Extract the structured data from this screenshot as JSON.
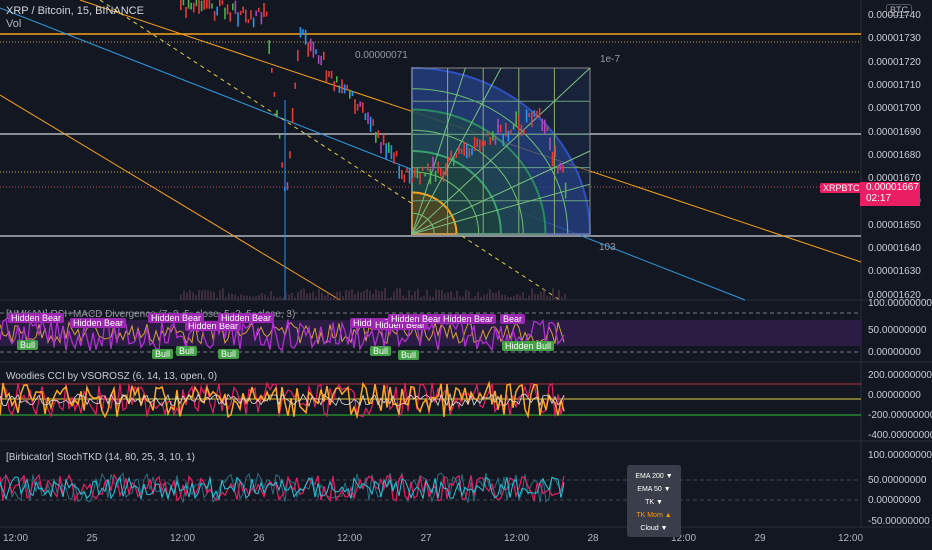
{
  "header": {
    "title": "XRP / Bitcoin, 15, BINANCE",
    "volume_label": "Vol",
    "currency_button": "BTC"
  },
  "price_axis": [
    "0.00001740",
    "0.00001730",
    "0.00001720",
    "0.00001710",
    "0.00001700",
    "0.00001690",
    "0.00001680",
    "0.00001670",
    "0.00001660",
    "0.00001650",
    "0.00001640",
    "0.00001630",
    "0.00001620"
  ],
  "last_price": {
    "symbol": "XRPBTC",
    "price": "0.00001667",
    "countdown": "02:17",
    "color": "#e91e63"
  },
  "drawing_labels": {
    "gann_price_range": "0.00000071",
    "gann_scale": "1e-7",
    "gann_bars": "103"
  },
  "indicators": [
    {
      "name": "[NMKAN] RSI+MACD Divergence (7, 9, 5, close, 5, 3, 5, close, 3)",
      "axis": [
        "100.00000000",
        "50.00000000",
        "0.00000000"
      ],
      "bear_tags": [
        "Hidden Bear",
        "Hidden Bear",
        "Hidden Bear",
        "Hidden Bear",
        "Hidden Bear",
        "Hidden Bear",
        "Hidden Bear",
        "Hidden Bear",
        "Hidden Bear",
        "Bear"
      ],
      "bull_tags": [
        "Bull",
        "Bull",
        "Bull",
        "Bull",
        "Bull",
        "Bull",
        "Hidden Bull"
      ]
    },
    {
      "name": "Woodies CCI by VSOROSZ (6, 14, 13, open, 0)",
      "axis": [
        "200.00000000",
        "0.00000000",
        "-200.00000000",
        "-400.00000000"
      ]
    },
    {
      "name": "[Birbicator] StochTKD (14, 80, 25, 3, 10, 1)",
      "axis": [
        "100.00000000",
        "50.00000000",
        "0.00000000",
        "-50.00000000"
      ]
    }
  ],
  "signal_popup": [
    {
      "label": "EMA 200 ▼"
    },
    {
      "label": "EMA 50 ▼"
    },
    {
      "label": "TK ▼"
    },
    {
      "label": "TK Mom ▲"
    },
    {
      "label": "Cloud ▼"
    }
  ],
  "time_axis": [
    "12:00",
    "25",
    "12:00",
    "26",
    "12:00",
    "27",
    "12:00",
    "28",
    "12:00",
    "29",
    "12:00"
  ]
}
